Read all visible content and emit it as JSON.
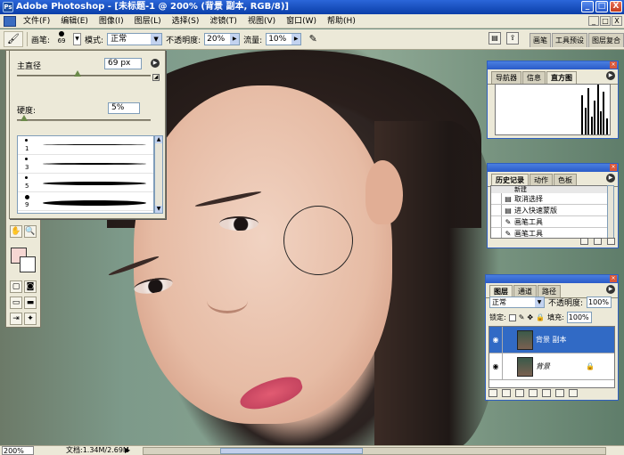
{
  "window": {
    "title": "Adobe Photoshop - [未标题-1 @ 200% (背景 副本, RGB/8)]",
    "controls": [
      "_",
      "□",
      "X"
    ]
  },
  "menubar": {
    "items": [
      "文件(F)",
      "编辑(E)",
      "图像(I)",
      "图层(L)",
      "选择(S)",
      "滤镜(T)",
      "视图(V)",
      "窗口(W)",
      "帮助(H)"
    ],
    "doc_controls": [
      "_",
      "□",
      "X"
    ]
  },
  "options": {
    "brush_label": "画笔:",
    "brush_size": "69",
    "mode_label": "模式:",
    "mode_value": "正常",
    "opacity_label": "不透明度:",
    "opacity_value": "20%",
    "flow_label": "流量:",
    "flow_value": "10%",
    "well_tabs": [
      "画笔",
      "工具预设",
      "图层复合"
    ]
  },
  "brush_picker": {
    "diameter_label": "主直径",
    "diameter_value": "69 px",
    "diameter_level": 0.45,
    "hardness_label": "硬度:",
    "hardness_value": "5%",
    "hardness_level": 0.05,
    "presets": [
      {
        "size": "1"
      },
      {
        "size": "3"
      },
      {
        "size": "5"
      },
      {
        "size": "9"
      }
    ]
  },
  "navigator": {
    "tabs": [
      "导航器",
      "信息",
      "直方图"
    ],
    "active_tab": "直方图"
  },
  "history": {
    "tabs": [
      "历史记录",
      "动作",
      "色板"
    ],
    "active_tab": "历史记录",
    "snapshot": "新建",
    "items": [
      {
        "label": "取消选择"
      },
      {
        "label": "进入快速蒙版"
      },
      {
        "label": "画笔工具"
      },
      {
        "label": "画笔工具"
      }
    ]
  },
  "layers": {
    "tabs": [
      "图层",
      "通道",
      "路径"
    ],
    "active_tab": "图层",
    "blend_mode": "正常",
    "opacity_label": "不透明度:",
    "opacity_value": "100%",
    "lock_label": "锁定:",
    "fill_label": "填充:",
    "fill_value": "100%",
    "items": [
      {
        "name": "背景 副本",
        "selected": true
      },
      {
        "name": "背景",
        "selected": false
      }
    ]
  },
  "status": {
    "zoom": "200%",
    "doc_info": "文档:1.34M/2.69M"
  },
  "colors": {
    "foreground": "#f6d7d3",
    "background": "#ffffff",
    "selection": "#316ac5"
  }
}
